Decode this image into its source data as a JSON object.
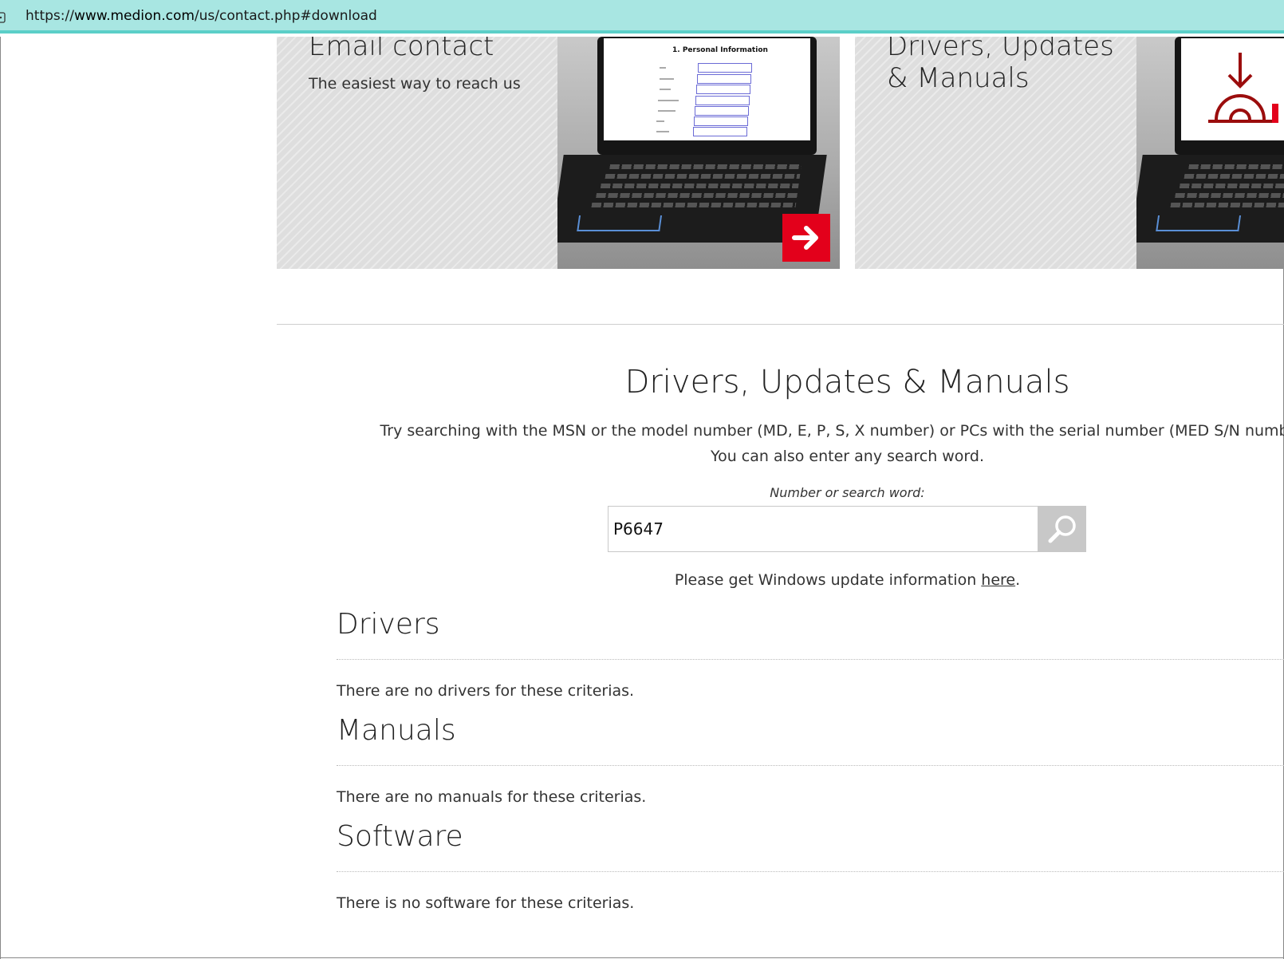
{
  "browser": {
    "url_prefix": "https://",
    "url_host": "www.medion.com",
    "url_path": "/us/contact.php#download"
  },
  "cards": {
    "email": {
      "title": "Email contact",
      "subtitle": "The easiest way to reach us",
      "screen_heading": "1. Personal Information"
    },
    "drivers": {
      "title": "Drivers, Updates\n& Manuals"
    }
  },
  "download": {
    "title": "Drivers, Updates & Manuals",
    "intro_line1": "Try searching with the MSN or the model number (MD, E, P, S, X number) or PCs with the serial number (MED S/N number).",
    "intro_line2": "You can also enter any search word.",
    "search_label": "Number or search word:",
    "search_value": "P6647",
    "windows_info_prefix": "Please get Windows update information ",
    "windows_info_link": "here",
    "windows_info_suffix": "."
  },
  "sections": {
    "drivers": {
      "title": "Drivers",
      "message": "There are no drivers for these criterias."
    },
    "manuals": {
      "title": "Manuals",
      "message": "There are no manuals for these criterias."
    },
    "software": {
      "title": "Software",
      "message": "There is no software for these criterias."
    }
  },
  "colors": {
    "accent_red": "#e3001b",
    "urlbar_bg": "#a8e6e2",
    "card_bg": "#dedede"
  }
}
